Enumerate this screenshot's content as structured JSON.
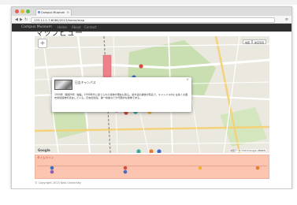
{
  "browser": {
    "tab_title": "Campus Museum",
    "url": "133.11.1.7:8080/2013/home/map"
  },
  "site": {
    "brand": "Campus Museum",
    "nav": [
      "Home",
      "About",
      "Contact"
    ]
  },
  "page": {
    "title": "マップビュー"
  },
  "map": {
    "zoom_controls": "+",
    "type_toggle": [
      "地図",
      "航空写真"
    ],
    "attribution": "地図データ ©2013 Google, ZENRIN",
    "logo": "Google",
    "marker_colors": [
      "#d94c3f",
      "#f2b233",
      "#3b6fc4",
      "#8e5cb8",
      "#3aa89a",
      "#e87c2f"
    ],
    "info_window": {
      "title": "日吉キャンパス",
      "body": "1934年（昭和9年）開設。1930年代に建てられた建物が現在も残る。並木道の銀杏が有名で、キャンパス内には多くの歴史的建造物が点在している。日吉記念館、第一校舎などが代表的な建物である。"
    }
  },
  "timeline": {
    "label": "タイムライン"
  },
  "footer": {
    "copyright": "© Copyright 2013 Keio University"
  }
}
